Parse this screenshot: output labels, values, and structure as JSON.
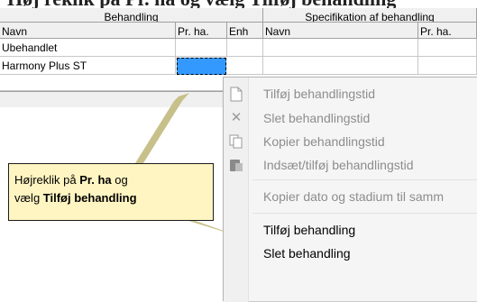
{
  "table": {
    "group_headers": [
      "Behandling",
      "Specifikation af behandling"
    ],
    "columns": [
      "Navn",
      "Pr. ha.",
      "Enh",
      "Navn",
      "Pr. ha."
    ],
    "rows": [
      [
        "Ubehandlet",
        "",
        "",
        "",
        ""
      ],
      [
        "Harmony Plus ST",
        "",
        "",
        "",
        ""
      ]
    ],
    "selected_cell_color": "#3399ff"
  },
  "context_menu": {
    "items": [
      {
        "label": "Tilføj behandlingstid",
        "icon": "new-document-icon",
        "enabled": false
      },
      {
        "label": "Slet behandlingstid",
        "icon": "delete-x-icon",
        "enabled": false
      },
      {
        "label": "Kopier behandlingstid",
        "icon": "copy-icon",
        "enabled": false
      },
      {
        "label": "Indsæt/tilføj behandlingstid",
        "icon": "paste-icon",
        "enabled": false
      },
      {
        "label": "Kopier dato og stadium til samm",
        "icon": "",
        "enabled": false
      },
      {
        "label": "Tilføj behandling",
        "icon": "",
        "enabled": true
      },
      {
        "label": "Slet behandling",
        "icon": "",
        "enabled": true
      }
    ]
  },
  "callout": {
    "line1_prefix": "Højreklik på ",
    "line1_bold": "Pr. ha",
    "line1_suffix": " og",
    "line2_prefix": "vælg ",
    "line2_bold": "Tilføj behandling",
    "background": "#fff5c2",
    "arrow_color": "#c8c08a"
  }
}
